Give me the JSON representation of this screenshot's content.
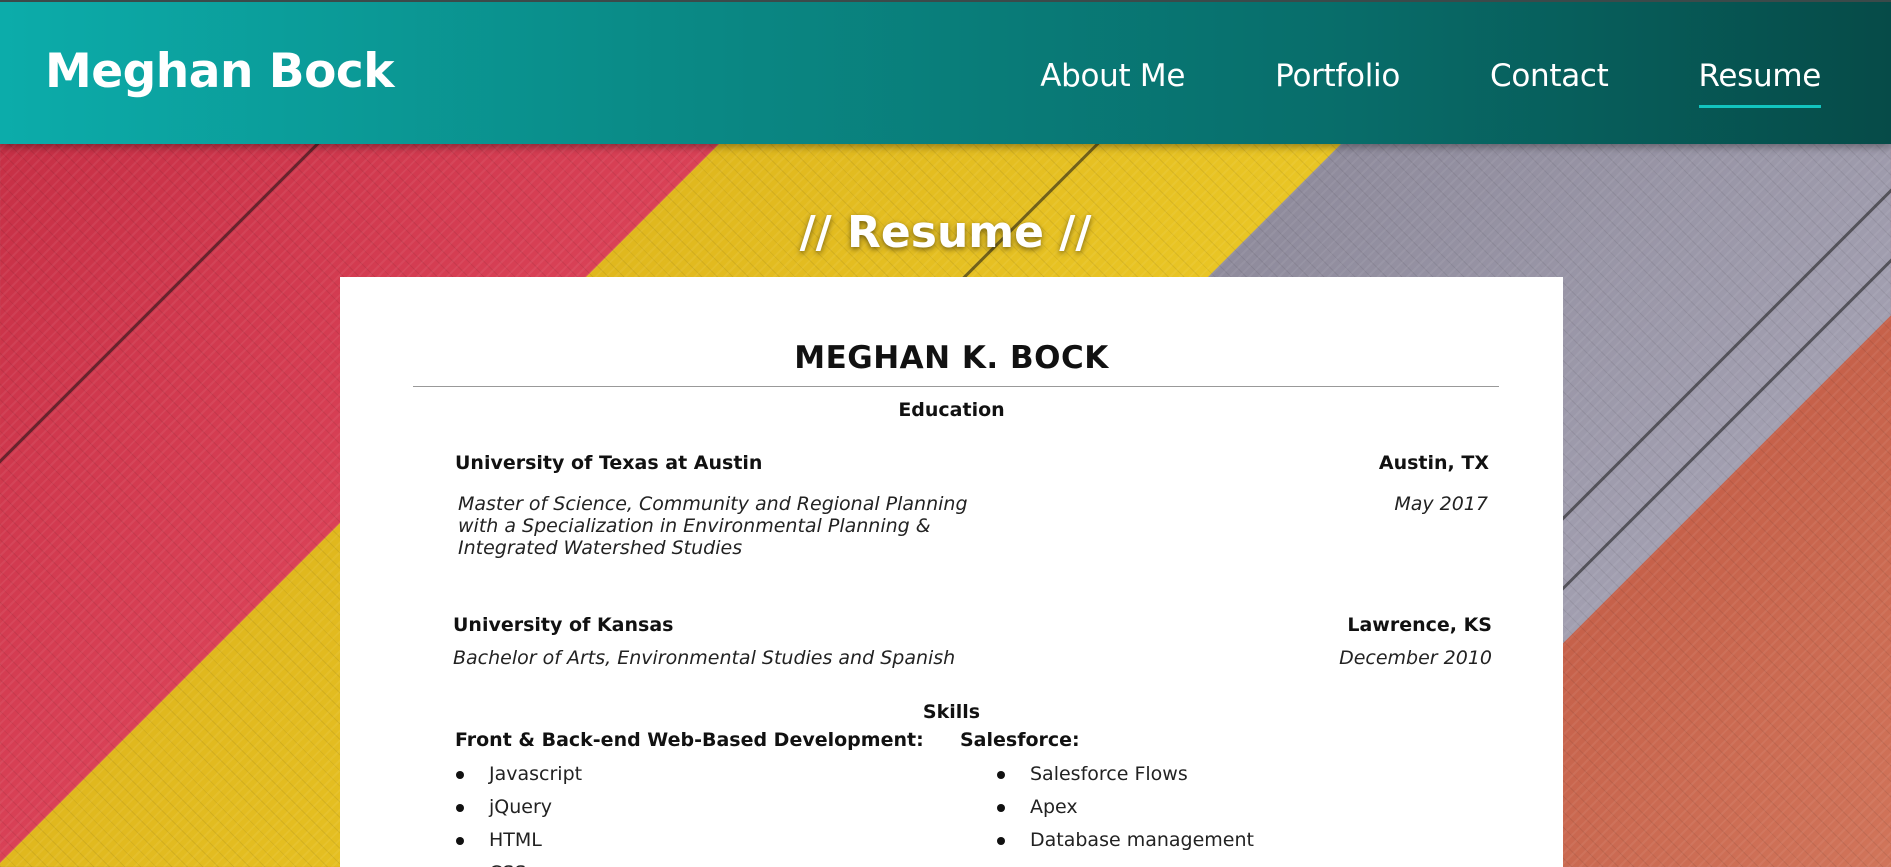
{
  "header": {
    "site_title": "Meghan Bock",
    "nav": [
      {
        "label": "About Me",
        "active": false
      },
      {
        "label": "Portfolio",
        "active": false
      },
      {
        "label": "Contact",
        "active": false
      },
      {
        "label": "Resume",
        "active": true
      }
    ],
    "accent_color": "#12c4bf"
  },
  "page_heading": "// Resume //",
  "resume": {
    "name": "MEGHAN K. BOCK",
    "education": {
      "title": "Education",
      "entries": [
        {
          "school": "University of Texas at Austin",
          "location": "Austin, TX",
          "degree_lines": [
            "Master of Science, Community and Regional Planning",
            "with a Specialization in Environmental Planning &",
            "Integrated Watershed Studies"
          ],
          "date": "May 2017"
        },
        {
          "school": "University of Kansas",
          "location": "Lawrence, KS",
          "degree_lines": [
            "Bachelor of Arts, Environmental Studies and Spanish"
          ],
          "date": "December 2010"
        }
      ]
    },
    "skills": {
      "title": "Skills",
      "groups": [
        {
          "heading": "Front & Back-end Web-Based Development:",
          "items": [
            "Javascript",
            "jQuery",
            "HTML",
            "CSS"
          ]
        },
        {
          "heading": "Salesforce:",
          "items": [
            "Salesforce Flows",
            "Apex",
            "Database management"
          ]
        }
      ]
    }
  }
}
